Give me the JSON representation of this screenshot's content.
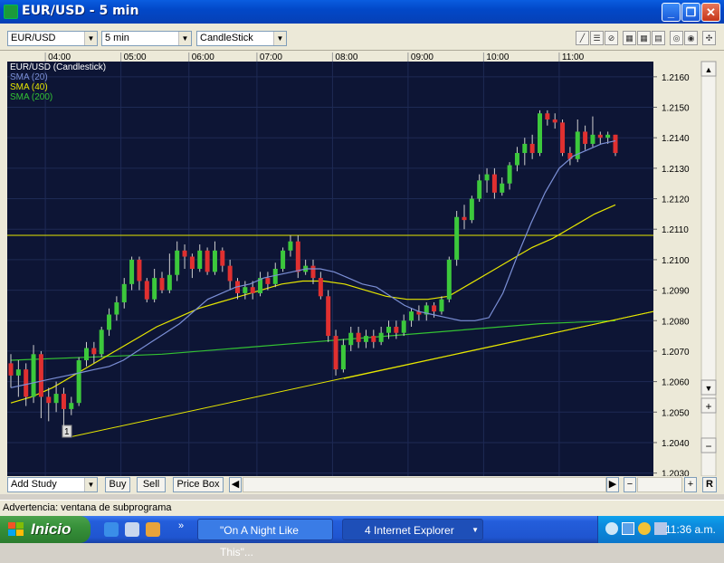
{
  "window": {
    "title": "EUR/USD - 5 min",
    "buttons": [
      "_",
      "❐",
      "✕"
    ]
  },
  "toolbar": {
    "symbol": "EUR/USD",
    "interval": "5 min",
    "chart_style": "CandleStick",
    "icons": [
      "pencil-icon",
      "horizontal-lines-icon",
      "no-draw-icon",
      "grid-icon",
      "grid-icon",
      "table-icon",
      "zoom-icon",
      "zoom-icon",
      "settings-icon"
    ]
  },
  "chart_data": {
    "type": "candlestick",
    "title": "EUR/USD (Candlestick)",
    "legend": [
      {
        "name": "SMA (20)",
        "color": "#7b8fd6"
      },
      {
        "name": "SMA (40)",
        "color": "#e6e600"
      },
      {
        "name": "SMA (200)",
        "color": "#33c233"
      }
    ],
    "x_ticks": [
      "04:00",
      "05:00",
      "06:00",
      "07:00",
      "08:00",
      "09:00",
      "10:00",
      "11:00"
    ],
    "y_ticks": [
      "1.2160",
      "1.2150",
      "1.2140",
      "1.2130",
      "1.2120",
      "1.2110",
      "1.2100",
      "1.2090",
      "1.2080",
      "1.2070",
      "1.2060",
      "1.2050",
      "1.2040",
      "1.2030"
    ],
    "ylim": [
      1.2029,
      1.2165
    ],
    "candles": [
      [
        1.2066,
        1.2062,
        1.2069,
        1.2058
      ],
      [
        1.2062,
        1.2064,
        1.2067,
        1.2055
      ],
      [
        1.2064,
        1.2055,
        1.2066,
        1.2052
      ],
      [
        1.2055,
        1.2069,
        1.2072,
        1.2053
      ],
      [
        1.2069,
        1.2055,
        1.207,
        1.2048
      ],
      [
        1.2055,
        1.2053,
        1.2058,
        1.2047
      ],
      [
        1.2053,
        1.2056,
        1.206,
        1.205
      ],
      [
        1.2056,
        1.2051,
        1.2058,
        1.2045
      ],
      [
        1.2051,
        1.2053,
        1.2055,
        1.2049
      ],
      [
        1.2053,
        1.2067,
        1.2068,
        1.2052
      ],
      [
        1.2067,
        1.2071,
        1.2073,
        1.2065
      ],
      [
        1.2071,
        1.2069,
        1.2073,
        1.2066
      ],
      [
        1.2069,
        1.2077,
        1.2078,
        1.2068
      ],
      [
        1.2077,
        1.2082,
        1.2084,
        1.2075
      ],
      [
        1.2082,
        1.2086,
        1.2088,
        1.208
      ],
      [
        1.2086,
        1.2092,
        1.2094,
        1.2084
      ],
      [
        1.2092,
        1.21,
        1.2101,
        1.209
      ],
      [
        1.21,
        1.2093,
        1.2101,
        1.209
      ],
      [
        1.2093,
        1.2087,
        1.2094,
        1.2086
      ],
      [
        1.2087,
        1.2094,
        1.2097,
        1.2086
      ],
      [
        1.2094,
        1.209,
        1.2096,
        1.2089
      ],
      [
        1.209,
        1.2095,
        1.2102,
        1.2089
      ],
      [
        1.2095,
        1.2103,
        1.2106,
        1.2093
      ],
      [
        1.2103,
        1.2101,
        1.2105,
        1.2097
      ],
      [
        1.2101,
        1.2097,
        1.2102,
        1.2094
      ],
      [
        1.2097,
        1.2103,
        1.2105,
        1.2096
      ],
      [
        1.2103,
        1.2096,
        1.2104,
        1.2095
      ],
      [
        1.2096,
        1.2103,
        1.2106,
        1.2095
      ],
      [
        1.2103,
        1.2098,
        1.2104,
        1.2096
      ],
      [
        1.2098,
        1.2093,
        1.21,
        1.209
      ],
      [
        1.2093,
        1.2089,
        1.2094,
        1.2087
      ],
      [
        1.2089,
        1.2091,
        1.2093,
        1.2087
      ],
      [
        1.2091,
        1.2089,
        1.2093,
        1.2087
      ],
      [
        1.2089,
        1.2094,
        1.2096,
        1.2088
      ],
      [
        1.2094,
        1.2092,
        1.2096,
        1.209
      ],
      [
        1.2092,
        1.2097,
        1.2099,
        1.2091
      ],
      [
        1.2097,
        1.2103,
        1.2104,
        1.2096
      ],
      [
        1.2103,
        1.2106,
        1.2108,
        1.2101
      ],
      [
        1.2106,
        1.2096,
        1.2108,
        1.2094
      ],
      [
        1.2096,
        1.2098,
        1.21,
        1.2095
      ],
      [
        1.2098,
        1.2094,
        1.21,
        1.2092
      ],
      [
        1.2094,
        1.2088,
        1.2096,
        1.2087
      ],
      [
        1.2088,
        1.2075,
        1.209,
        1.2073
      ],
      [
        1.2075,
        1.2064,
        1.2077,
        1.2062
      ],
      [
        1.2064,
        1.2072,
        1.2074,
        1.2063
      ],
      [
        1.2072,
        1.2076,
        1.2078,
        1.207
      ],
      [
        1.2076,
        1.2073,
        1.2078,
        1.2071
      ],
      [
        1.2073,
        1.2075,
        1.2077,
        1.2071
      ],
      [
        1.2075,
        1.2073,
        1.2077,
        1.2071
      ],
      [
        1.2073,
        1.2076,
        1.2078,
        1.2072
      ],
      [
        1.2076,
        1.2078,
        1.208,
        1.2074
      ],
      [
        1.2078,
        1.2076,
        1.208,
        1.2074
      ],
      [
        1.2076,
        1.208,
        1.2082,
        1.2075
      ],
      [
        1.208,
        1.2083,
        1.2084,
        1.2078
      ],
      [
        1.2083,
        1.2082,
        1.2085,
        1.208
      ],
      [
        1.2082,
        1.2085,
        1.2086,
        1.208
      ],
      [
        1.2085,
        1.2083,
        1.2086,
        1.2081
      ],
      [
        1.2083,
        1.2087,
        1.2088,
        1.2082
      ],
      [
        1.2087,
        1.21,
        1.2101,
        1.2086
      ],
      [
        1.21,
        1.2114,
        1.2116,
        1.2098
      ],
      [
        1.2114,
        1.2113,
        1.2118,
        1.211
      ],
      [
        1.2113,
        1.212,
        1.2121,
        1.2112
      ],
      [
        1.212,
        1.2126,
        1.2128,
        1.2119
      ],
      [
        1.2126,
        1.2128,
        1.213,
        1.2122
      ],
      [
        1.2128,
        1.2122,
        1.213,
        1.212
      ],
      [
        1.2122,
        1.2125,
        1.2127,
        1.2121
      ],
      [
        1.2125,
        1.2131,
        1.2132,
        1.2123
      ],
      [
        1.2131,
        1.2135,
        1.2137,
        1.2129
      ],
      [
        1.2135,
        1.2138,
        1.214,
        1.2131
      ],
      [
        1.2138,
        1.2135,
        1.2141,
        1.2133
      ],
      [
        1.2135,
        1.2148,
        1.2149,
        1.2134
      ],
      [
        1.2148,
        1.2146,
        1.2149,
        1.2144
      ],
      [
        1.2146,
        1.2145,
        1.2148,
        1.2143
      ],
      [
        1.2145,
        1.2135,
        1.2146,
        1.2134
      ],
      [
        1.2135,
        1.2133,
        1.2137,
        1.2131
      ],
      [
        1.2133,
        1.2142,
        1.2146,
        1.2132
      ],
      [
        1.2142,
        1.2138,
        1.2144,
        1.2136
      ],
      [
        1.2138,
        1.2141,
        1.2147,
        1.2137
      ],
      [
        1.2141,
        1.214,
        1.2142,
        1.2138
      ],
      [
        1.214,
        1.2141,
        1.2142,
        1.2138
      ],
      [
        1.2141,
        1.2135,
        1.2141,
        1.2134
      ]
    ],
    "sma20": [
      1.2058,
      1.2059,
      1.206,
      1.2061,
      1.2062,
      1.2063,
      1.2064,
      1.2065,
      1.2067,
      1.207,
      1.2073,
      1.2076,
      1.2079,
      1.2083,
      1.2087,
      1.2089,
      1.2091,
      1.2092,
      1.2094,
      1.2095,
      1.2096,
      1.2097,
      1.2097,
      1.2096,
      1.2094,
      1.2092,
      1.2091,
      1.2088,
      1.2085,
      1.2083,
      1.2082,
      1.2081,
      1.208,
      1.208,
      1.2081,
      1.2089,
      1.2101,
      1.2112,
      1.2122,
      1.213,
      1.2134,
      1.2136,
      1.2138,
      1.2139
    ],
    "sma40": [
      1.2053,
      1.2055,
      1.2058,
      1.2062,
      1.2066,
      1.207,
      1.2074,
      1.2078,
      1.2081,
      1.2084,
      1.2086,
      1.2088,
      1.209,
      1.2092,
      1.2093,
      1.2093,
      1.2092,
      1.209,
      1.2088,
      1.2087,
      1.2087,
      1.2088,
      1.2092,
      1.2096,
      1.21,
      1.2104,
      1.2107,
      1.2111,
      1.2115,
      1.2118
    ],
    "sma200": [
      1.2067,
      1.2068,
      1.2069,
      1.2071,
      1.2073,
      1.2075,
      1.2077,
      1.2079,
      1.208
    ],
    "resistance_level": 1.2108,
    "trendlines": [
      {
        "color": "#e6e600",
        "from": [
          0,
          1.2042
        ],
        "to": [
          86,
          1.2083
        ]
      },
      {
        "color": "#e6e600",
        "from": [
          52,
          1.2061
        ],
        "to": [
          86,
          1.2083
        ]
      }
    ],
    "marker_label": "1"
  },
  "bottom": {
    "add_study": "Add Study",
    "buy": "Buy",
    "sell": "Sell",
    "price_box": "Price Box"
  },
  "status_text": "Advertencia: ventana de subprograma",
  "taskbar": {
    "start": "Inicio",
    "tasks": [
      {
        "label": "\"On A Night Like This\"..."
      },
      {
        "label": "4 Internet Explorer"
      }
    ],
    "clock": "11:36 a.m."
  }
}
